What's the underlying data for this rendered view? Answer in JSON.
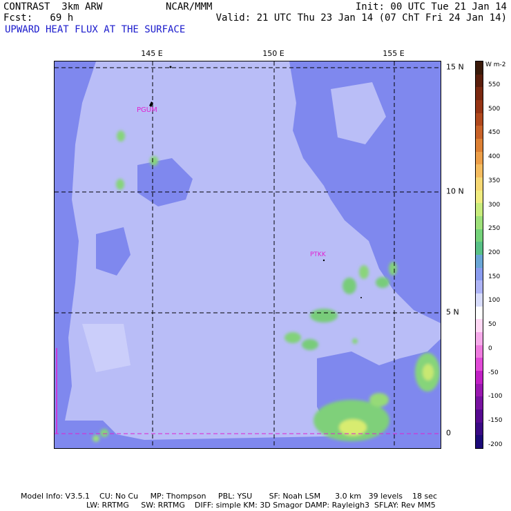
{
  "header": {
    "model": "CONTRAST  3km ARW",
    "forecast": "Fcst:   69 h",
    "field": "UPWARD HEAT FLUX AT THE SURFACE",
    "center": "NCAR/MMM",
    "init": "Init: 00 UTC Tue 21 Jan 14",
    "valid": "Valid: 21 UTC Thu 23 Jan 14 (07 ChT Fri 24 Jan 14)"
  },
  "map": {
    "lon_labels": [
      "145 E",
      "150 E",
      "155 E"
    ],
    "lat_labels": [
      "15 N",
      "10 N",
      "5 N",
      "0"
    ],
    "stations": [
      "PGUM",
      "PTKK"
    ],
    "station_color": "#e020d0"
  },
  "colorbar": {
    "units": "W m-2",
    "labels": [
      "550",
      "500",
      "450",
      "400",
      "350",
      "300",
      "250",
      "200",
      "150",
      "100",
      "50",
      "0",
      "-50",
      "-100",
      "-150",
      "-200"
    ],
    "colors": [
      "#3a1a0a",
      "#5a1e0c",
      "#7a2810",
      "#963414",
      "#b0481c",
      "#c86228",
      "#dc8034",
      "#ec9e48",
      "#f4bc60",
      "#f6d874",
      "#f0ec80",
      "#c8ec7c",
      "#9ee07a",
      "#74d27a",
      "#58c086",
      "#6aa6d6",
      "#8a9cef",
      "#aeb4f6",
      "#d8dcfb",
      "#ffffff",
      "#ffd8f4",
      "#f6aaea",
      "#ee7ade",
      "#e04ad6",
      "#c020c4",
      "#9a18b0",
      "#7812a0",
      "#560a90",
      "#3a0a84",
      "#1c0a78"
    ]
  },
  "footer": {
    "line1": "Model Info: V3.5.1    CU: No Cu     MP: Thompson     PBL: YSU       SF: Noah LSM      3.0 km   39 levels    18 sec",
    "line2": "LW: RRTMG     SW: RRTMG    DIFF: simple KM: 3D Smagor DAMP: Rayleigh3  SFLAY: Rev MM5"
  }
}
